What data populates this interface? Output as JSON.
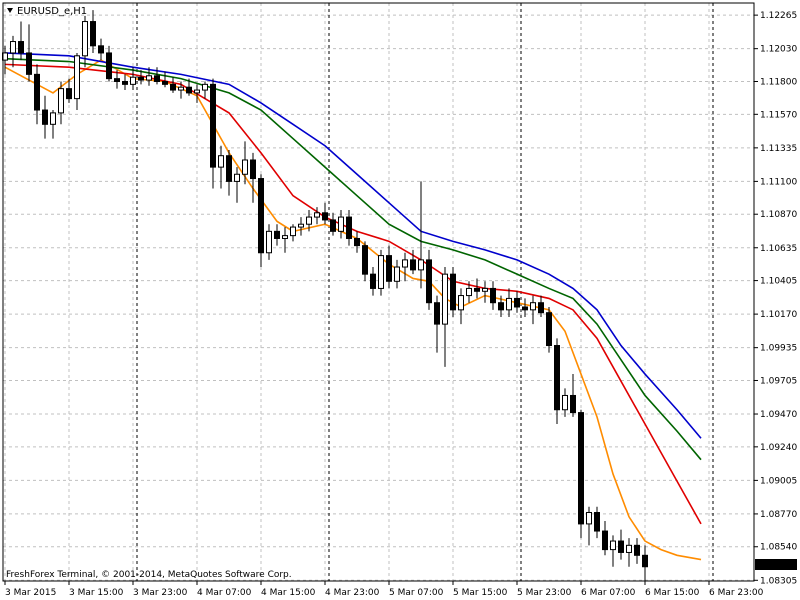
{
  "window": {
    "symbol_label": "EURUSD_e,H1",
    "copyright": "FreshForex Terminal, © 2001-2014, MetaQuotes Software Corp."
  },
  "colors": {
    "background": "#ffffff",
    "grid": "#c0c0c0",
    "candle_bull": "#ffffff",
    "candle_bear": "#000000",
    "ma_fast": "#ff8c00",
    "ma_mid": "#e00000",
    "ma_slow": "#006400",
    "ma_slowest": "#0000cc",
    "current_price_bg": "#000000",
    "current_price_fg": "#ffffff"
  },
  "chart_data": {
    "type": "candlestick",
    "symbol": "EURUSD_e",
    "timeframe": "H1",
    "ylim": [
      1.083,
      1.1235
    ],
    "y_ticks": [
      "1.12265",
      "1.12030",
      "1.11800",
      "1.11570",
      "1.11335",
      "1.11100",
      "1.10870",
      "1.10635",
      "1.10405",
      "1.10170",
      "1.09935",
      "1.09705",
      "1.09470",
      "1.09240",
      "1.09005",
      "1.08770",
      "1.08540",
      "1.08305"
    ],
    "x_ticks": [
      {
        "bar": 0,
        "label": "3 Mar 2015"
      },
      {
        "bar": 8,
        "label": "3 Mar 15:00"
      },
      {
        "bar": 16,
        "label": "3 Mar 23:00"
      },
      {
        "bar": 24,
        "label": "4 Mar 07:00"
      },
      {
        "bar": 32,
        "label": "4 Mar 15:00"
      },
      {
        "bar": 40,
        "label": "4 Mar 23:00"
      },
      {
        "bar": 48,
        "label": "5 Mar 07:00"
      },
      {
        "bar": 56,
        "label": "5 Mar 15:00"
      },
      {
        "bar": 64,
        "label": "5 Mar 23:00"
      },
      {
        "bar": 72,
        "label": "6 Mar 07:00"
      },
      {
        "bar": 80,
        "label": "6 Mar 15:00"
      },
      {
        "bar": 88,
        "label": "6 Mar 23:00"
      }
    ],
    "day_separators": [
      17,
      41,
      65,
      89
    ],
    "current_price": "1.08399",
    "candles": [
      [
        1.1195,
        1.1205,
        1.1185,
        1.12
      ],
      [
        1.12,
        1.1212,
        1.119,
        1.1208
      ],
      [
        1.1208,
        1.1222,
        1.1195,
        1.12
      ],
      [
        1.12,
        1.122,
        1.118,
        1.1185
      ],
      [
        1.1185,
        1.1192,
        1.115,
        1.116
      ],
      [
        1.116,
        1.117,
        1.114,
        1.115
      ],
      [
        1.115,
        1.116,
        1.114,
        1.1158
      ],
      [
        1.1158,
        1.118,
        1.115,
        1.1175
      ],
      [
        1.1175,
        1.1182,
        1.1165,
        1.1168
      ],
      [
        1.1168,
        1.12,
        1.116,
        1.1198
      ],
      [
        1.1198,
        1.1226,
        1.119,
        1.1222
      ],
      [
        1.1222,
        1.123,
        1.12,
        1.1205
      ],
      [
        1.1205,
        1.121,
        1.1195,
        1.12
      ],
      [
        1.12,
        1.1205,
        1.118,
        1.1182
      ],
      [
        1.1182,
        1.1188,
        1.1175,
        1.118
      ],
      [
        1.118,
        1.1185,
        1.1174,
        1.1178
      ],
      [
        1.1178,
        1.119,
        1.1174,
        1.1183
      ],
      [
        1.1183,
        1.1188,
        1.1178,
        1.1181
      ],
      [
        1.1181,
        1.119,
        1.1177,
        1.1184
      ],
      [
        1.1184,
        1.119,
        1.1178,
        1.118
      ],
      [
        1.118,
        1.1187,
        1.1176,
        1.1178
      ],
      [
        1.1178,
        1.1183,
        1.1172,
        1.1174
      ],
      [
        1.1174,
        1.118,
        1.1168,
        1.1176
      ],
      [
        1.1176,
        1.1182,
        1.117,
        1.1172
      ],
      [
        1.1172,
        1.1178,
        1.1165,
        1.1174
      ],
      [
        1.1174,
        1.118,
        1.1168,
        1.1178
      ],
      [
        1.1178,
        1.1182,
        1.1105,
        1.112
      ],
      [
        1.112,
        1.1135,
        1.1105,
        1.1128
      ],
      [
        1.1128,
        1.1132,
        1.11,
        1.111
      ],
      [
        1.111,
        1.112,
        1.1095,
        1.1115
      ],
      [
        1.1115,
        1.1138,
        1.1108,
        1.1125
      ],
      [
        1.1125,
        1.113,
        1.1095,
        1.1112
      ],
      [
        1.1112,
        1.1115,
        1.105,
        1.106
      ],
      [
        1.106,
        1.108,
        1.1055,
        1.1075
      ],
      [
        1.1075,
        1.108,
        1.1065,
        1.107
      ],
      [
        1.107,
        1.1078,
        1.106,
        1.1072
      ],
      [
        1.1072,
        1.108,
        1.1068,
        1.1078
      ],
      [
        1.1078,
        1.1085,
        1.1072,
        1.108
      ],
      [
        1.108,
        1.109,
        1.1075,
        1.1085
      ],
      [
        1.1085,
        1.1092,
        1.108,
        1.1088
      ],
      [
        1.1088,
        1.1095,
        1.108,
        1.1083
      ],
      [
        1.1083,
        1.1088,
        1.1072,
        1.1075
      ],
      [
        1.1075,
        1.109,
        1.107,
        1.1085
      ],
      [
        1.1085,
        1.109,
        1.1065,
        1.107
      ],
      [
        1.107,
        1.1075,
        1.106,
        1.1065
      ],
      [
        1.1065,
        1.1068,
        1.104,
        1.1045
      ],
      [
        1.1045,
        1.105,
        1.103,
        1.1035
      ],
      [
        1.1035,
        1.1062,
        1.103,
        1.1058
      ],
      [
        1.1058,
        1.1065,
        1.1035,
        1.104
      ],
      [
        1.104,
        1.1055,
        1.1035,
        1.105
      ],
      [
        1.105,
        1.106,
        1.104,
        1.1055
      ],
      [
        1.1055,
        1.1062,
        1.1045,
        1.1048
      ],
      [
        1.1048,
        1.111,
        1.1035,
        1.1055
      ],
      [
        1.1055,
        1.1062,
        1.102,
        1.1025
      ],
      [
        1.1025,
        1.103,
        1.099,
        1.101
      ],
      [
        1.101,
        1.105,
        1.098,
        1.1045
      ],
      [
        1.1045,
        1.105,
        1.1015,
        1.102
      ],
      [
        1.102,
        1.1035,
        1.101,
        1.103
      ],
      [
        1.103,
        1.104,
        1.1025,
        1.1035
      ],
      [
        1.1035,
        1.1042,
        1.1028,
        1.1033
      ],
      [
        1.1033,
        1.104,
        1.1025,
        1.1035
      ],
      [
        1.1035,
        1.104,
        1.102,
        1.1025
      ],
      [
        1.1025,
        1.103,
        1.1015,
        1.102
      ],
      [
        1.102,
        1.1035,
        1.1015,
        1.1028
      ],
      [
        1.1028,
        1.1033,
        1.1018,
        1.1022
      ],
      [
        1.1022,
        1.1028,
        1.1015,
        1.102
      ],
      [
        1.102,
        1.103,
        1.101,
        1.1025
      ],
      [
        1.1025,
        1.103,
        1.1015,
        1.1018
      ],
      [
        1.1018,
        1.1022,
        1.099,
        1.0995
      ],
      [
        1.0995,
        1.1,
        1.094,
        1.095
      ],
      [
        1.095,
        1.0965,
        1.0945,
        1.096
      ],
      [
        1.096,
        1.0975,
        1.0945,
        1.0948
      ],
      [
        1.0948,
        1.095,
        1.086,
        1.087
      ],
      [
        1.087,
        1.0882,
        1.0855,
        1.0878
      ],
      [
        1.0878,
        1.0882,
        1.086,
        1.0865
      ],
      [
        1.0865,
        1.0872,
        1.0848,
        1.0852
      ],
      [
        1.0852,
        1.0862,
        1.084,
        1.0858
      ],
      [
        1.0858,
        1.0866,
        1.0845,
        1.085
      ],
      [
        1.085,
        1.086,
        1.084,
        1.0855
      ],
      [
        1.0855,
        1.086,
        1.0842,
        1.0848
      ],
      [
        1.0848,
        1.0855,
        1.083,
        1.084
      ]
    ],
    "ma_series": [
      {
        "color_key": "ma_fast",
        "points": [
          [
            0,
            1.119
          ],
          [
            6,
            1.1172
          ],
          [
            9,
            1.1185
          ],
          [
            12,
            1.1195
          ],
          [
            16,
            1.1182
          ],
          [
            20,
            1.118
          ],
          [
            24,
            1.117
          ],
          [
            28,
            1.113
          ],
          [
            31,
            1.1105
          ],
          [
            34,
            1.1082
          ],
          [
            36,
            1.1075
          ],
          [
            40,
            1.108
          ],
          [
            44,
            1.107
          ],
          [
            48,
            1.1052
          ],
          [
            51,
            1.1042
          ],
          [
            53,
            1.104
          ],
          [
            55,
            1.1028
          ],
          [
            57,
            1.1022
          ],
          [
            60,
            1.103
          ],
          [
            64,
            1.1025
          ],
          [
            68,
            1.102
          ],
          [
            70,
            1.1005
          ],
          [
            72,
            1.0975
          ],
          [
            74,
            1.0945
          ],
          [
            76,
            1.0905
          ],
          [
            78,
            1.0875
          ],
          [
            80,
            1.0858
          ],
          [
            82,
            1.0852
          ],
          [
            84,
            1.0848
          ],
          [
            87,
            1.0845
          ]
        ]
      },
      {
        "color_key": "ma_mid",
        "points": [
          [
            0,
            1.1192
          ],
          [
            8,
            1.119
          ],
          [
            16,
            1.1185
          ],
          [
            22,
            1.1178
          ],
          [
            28,
            1.1158
          ],
          [
            32,
            1.113
          ],
          [
            36,
            1.11
          ],
          [
            40,
            1.1085
          ],
          [
            44,
            1.1075
          ],
          [
            48,
            1.1068
          ],
          [
            52,
            1.1055
          ],
          [
            56,
            1.104
          ],
          [
            60,
            1.1035
          ],
          [
            64,
            1.1033
          ],
          [
            68,
            1.1028
          ],
          [
            71,
            1.102
          ],
          [
            74,
            1.1
          ],
          [
            77,
            1.097
          ],
          [
            80,
            1.094
          ],
          [
            84,
            1.09
          ],
          [
            87,
            1.087
          ]
        ]
      },
      {
        "color_key": "ma_slow",
        "points": [
          [
            0,
            1.1196
          ],
          [
            8,
            1.1194
          ],
          [
            16,
            1.1188
          ],
          [
            22,
            1.1182
          ],
          [
            28,
            1.1172
          ],
          [
            32,
            1.116
          ],
          [
            36,
            1.114
          ],
          [
            40,
            1.112
          ],
          [
            44,
            1.11
          ],
          [
            48,
            1.108
          ],
          [
            52,
            1.1068
          ],
          [
            56,
            1.1062
          ],
          [
            60,
            1.1055
          ],
          [
            64,
            1.1045
          ],
          [
            68,
            1.1035
          ],
          [
            71,
            1.1028
          ],
          [
            74,
            1.101
          ],
          [
            77,
            1.0985
          ],
          [
            80,
            1.096
          ],
          [
            84,
            1.0935
          ],
          [
            87,
            1.0915
          ]
        ]
      },
      {
        "color_key": "ma_slowest",
        "points": [
          [
            0,
            1.12
          ],
          [
            8,
            1.1198
          ],
          [
            16,
            1.119
          ],
          [
            22,
            1.1185
          ],
          [
            28,
            1.1178
          ],
          [
            32,
            1.1165
          ],
          [
            36,
            1.115
          ],
          [
            40,
            1.1135
          ],
          [
            44,
            1.1115
          ],
          [
            48,
            1.1095
          ],
          [
            52,
            1.1075
          ],
          [
            56,
            1.1068
          ],
          [
            60,
            1.1062
          ],
          [
            64,
            1.1055
          ],
          [
            68,
            1.1045
          ],
          [
            71,
            1.1035
          ],
          [
            74,
            1.102
          ],
          [
            77,
            1.0995
          ],
          [
            80,
            1.0975
          ],
          [
            84,
            1.095
          ],
          [
            87,
            1.093
          ]
        ]
      }
    ]
  }
}
